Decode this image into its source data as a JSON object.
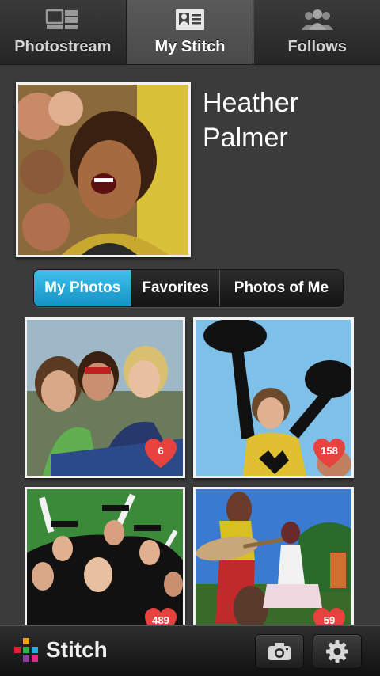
{
  "top_tabs": [
    {
      "label": "Photostream",
      "icon": "photostream-icon",
      "active": false
    },
    {
      "label": "My Stitch",
      "icon": "profile-card-icon",
      "active": true
    },
    {
      "label": "Follows",
      "icon": "people-icon",
      "active": false
    }
  ],
  "profile": {
    "first_name": "Heather",
    "last_name": "Palmer"
  },
  "segments": [
    {
      "label": "My Photos",
      "active": true
    },
    {
      "label": "Favorites",
      "active": false
    },
    {
      "label": "Photos of Me",
      "active": false
    }
  ],
  "photos": [
    {
      "likes": "6"
    },
    {
      "likes": "158"
    },
    {
      "likes": "489"
    },
    {
      "likes": "59"
    }
  ],
  "bottom_bar": {
    "brand": "Stitch",
    "camera_icon": "camera-icon",
    "settings_icon": "gear-icon"
  },
  "colors": {
    "accent": "#2aaee0",
    "heart": "#e8423e",
    "background": "#3b3b3b"
  }
}
